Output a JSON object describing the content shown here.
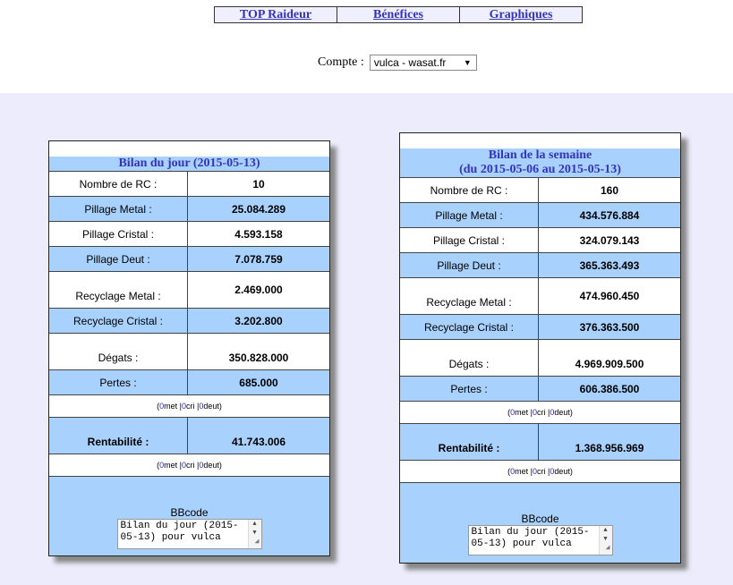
{
  "nav": {
    "top_raideur": "TOP Raideur",
    "benefices": "Bénéfices",
    "graphiques": "Graphiques"
  },
  "account": {
    "label": "Compte :",
    "selected": "vulca - wasat.fr"
  },
  "day": {
    "title": "Bilan du jour (2015-05-13)",
    "rows": {
      "nb_rc": {
        "label": "Nombre de RC :",
        "value": "10"
      },
      "pillage_metal": {
        "label": "Pillage Metal :",
        "value": "25.084.289"
      },
      "pillage_cristal": {
        "label": "Pillage Cristal :",
        "value": "4.593.158"
      },
      "pillage_deut": {
        "label": "Pillage Deut :",
        "value": "7.078.759"
      },
      "recyclage_metal": {
        "label": "Recyclage Metal :",
        "value": "2.469.000"
      },
      "recyclage_cristal": {
        "label": "Recyclage Cristal :",
        "value": "3.202.800"
      },
      "degats": {
        "label": "Dégats :",
        "value": "350.828.000"
      },
      "pertes": {
        "label": "Pertes :",
        "value": "685.000"
      },
      "rentabilite": {
        "label": "Rentabilité :",
        "value": "41.743.006"
      }
    },
    "pertes_note": {
      "met": "0",
      "cri": "0",
      "deut": "0"
    },
    "rentabilite_note": {
      "met": "0",
      "cri": "0",
      "deut": "0"
    },
    "bbcode": {
      "label": "BBcode",
      "text": "Bilan du jour (2015-05-13) pour vulca"
    }
  },
  "week": {
    "title_line1": "Bilan de la semaine",
    "title_line2": "(du 2015-05-06 au 2015-05-13)",
    "rows": {
      "nb_rc": {
        "label": "Nombre de RC :",
        "value": "160"
      },
      "pillage_metal": {
        "label": "Pillage Metal :",
        "value": "434.576.884"
      },
      "pillage_cristal": {
        "label": "Pillage Cristal :",
        "value": "324.079.143"
      },
      "pillage_deut": {
        "label": "Pillage Deut :",
        "value": "365.363.493"
      },
      "recyclage_metal": {
        "label": "Recyclage Metal :",
        "value": "474.960.450"
      },
      "recyclage_cristal": {
        "label": "Recyclage Cristal :",
        "value": "376.363.500"
      },
      "degats": {
        "label": "Dégats :",
        "value": "4.969.909.500"
      },
      "pertes": {
        "label": "Pertes :",
        "value": "606.386.500"
      },
      "rentabilite": {
        "label": "Rentabilité :",
        "value": "1.368.956.969"
      }
    },
    "pertes_note": {
      "met": "0",
      "cri": "0",
      "deut": "0"
    },
    "rentabilite_note": {
      "met": "0",
      "cri": "0",
      "deut": "0"
    },
    "bbcode": {
      "label": "BBcode",
      "text": "Bilan du jour (2015-05-13) pour vulca"
    }
  },
  "note_words": {
    "met": " met | ",
    "cri": " cri | ",
    "deut": " deut)"
  },
  "colors": {
    "panel_blue": "#a9d1fd",
    "lavender_bg": "#ececfd",
    "title_blue": "#3333bb"
  }
}
